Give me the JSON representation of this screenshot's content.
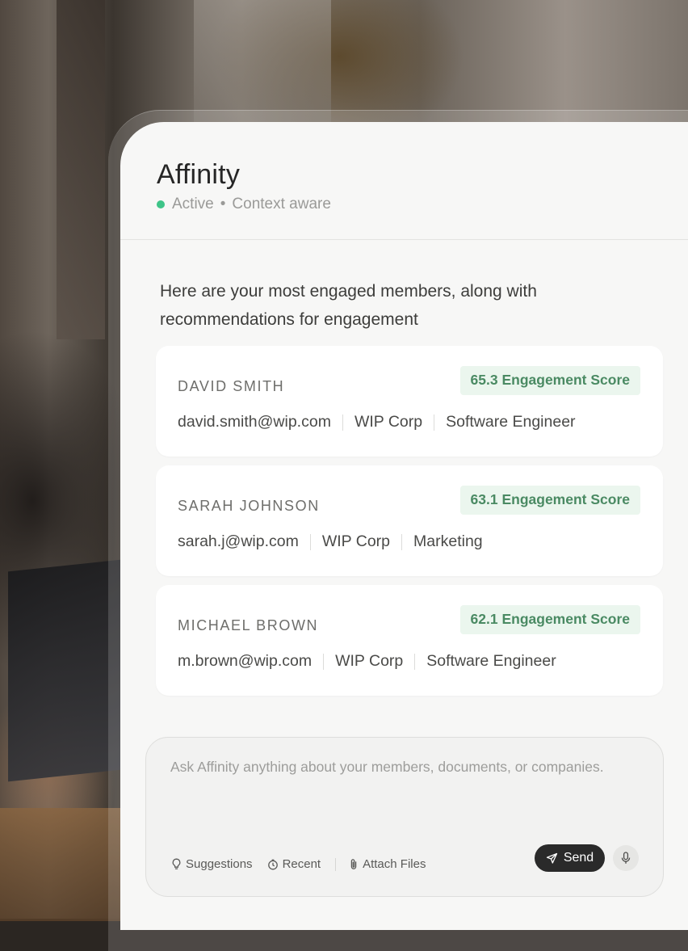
{
  "app": {
    "title": "Affinity",
    "status_active": "Active",
    "status_separator": "•",
    "status_context": "Context aware",
    "status_color": "#3ec488"
  },
  "message": {
    "intro": "Here are your most engaged members, along with recommendations for engagement"
  },
  "members": [
    {
      "name": "DAVID SMITH",
      "score": "65.3 Engagement Score",
      "email": "david.smith@wip.com",
      "company": "WIP Corp",
      "role": "Software Engineer"
    },
    {
      "name": "SARAH JOHNSON",
      "score": "63.1 Engagement Score",
      "email": "sarah.j@wip.com",
      "company": "WIP Corp",
      "role": "Marketing"
    },
    {
      "name": "MICHAEL BROWN",
      "score": "62.1 Engagement Score",
      "email": "m.brown@wip.com",
      "company": "WIP Corp",
      "role": "Software Engineer"
    }
  ],
  "composer": {
    "placeholder": "Ask Affinity anything about your members, documents, or companies.",
    "suggestions_label": "Suggestions",
    "suggestions_icon": "lightbulb-icon",
    "recent_label": "Recent",
    "recent_icon": "clock-icon",
    "attach_label": "Attach Files",
    "attach_icon": "paperclip-icon",
    "send_label": "Send",
    "send_icon": "send-icon",
    "mic_icon": "microphone-icon"
  },
  "colors": {
    "badge_bg": "#ebf6ee",
    "badge_text": "#4a8a63",
    "send_bg": "#2a2a2a"
  }
}
